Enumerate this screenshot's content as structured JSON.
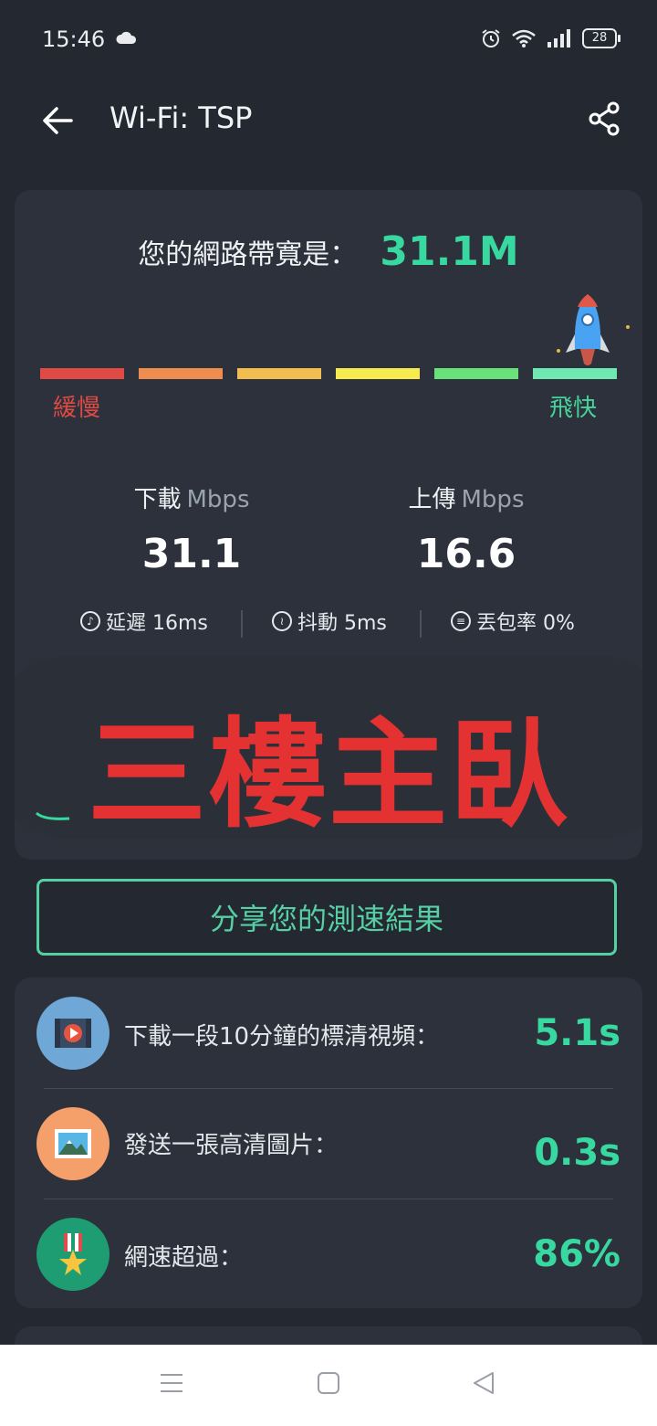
{
  "status_bar": {
    "time": "15:46",
    "battery": "28",
    "icons": [
      "cloud-icon",
      "alarm-icon",
      "wifi-icon",
      "signal-icon",
      "battery-icon"
    ]
  },
  "app_bar": {
    "title": "Wi-Fi: TSP",
    "icons": [
      "back-arrow-icon",
      "share-icon"
    ]
  },
  "result": {
    "bandwidth_label": "您的網路帶寬是：",
    "bandwidth_value": "31.1M",
    "scale_colors": [
      "#e04a45",
      "#ef8c4f",
      "#f2bd4f",
      "#f7ea4f",
      "#6ae07a",
      "#6fe8b2"
    ],
    "scale_slow": "緩慢",
    "scale_fast": "飛快",
    "scale_slow_color": "#e04a45",
    "scale_fast_color": "#45d39a",
    "download_label": "下載",
    "upload_label": "上傳",
    "unit": "Mbps",
    "download_value": "31.1",
    "upload_value": "16.6",
    "latency_label": "延遲 16ms",
    "jitter_label": "抖動 5ms",
    "loss_label": "丟包率 0%"
  },
  "overlay_text": "三樓主臥",
  "share_button": "分享您的測速結果",
  "info_items": [
    {
      "label": "下載一段10分鐘的標清視頻：",
      "value": "5.1s",
      "icon": "video-icon",
      "bg": "#6fa8d6"
    },
    {
      "label": "發送一張高清圖片：",
      "value": "0.3s",
      "icon": "image-icon",
      "bg": "#f5a06a"
    },
    {
      "label": "網速超過：",
      "value": "86%",
      "icon": "medal-icon",
      "bg": "#1f9d72"
    }
  ],
  "accent_color": "#38d9a0",
  "nav_bar": {
    "icons": [
      "menu-icon",
      "home-square-icon",
      "back-triangle-icon"
    ]
  }
}
